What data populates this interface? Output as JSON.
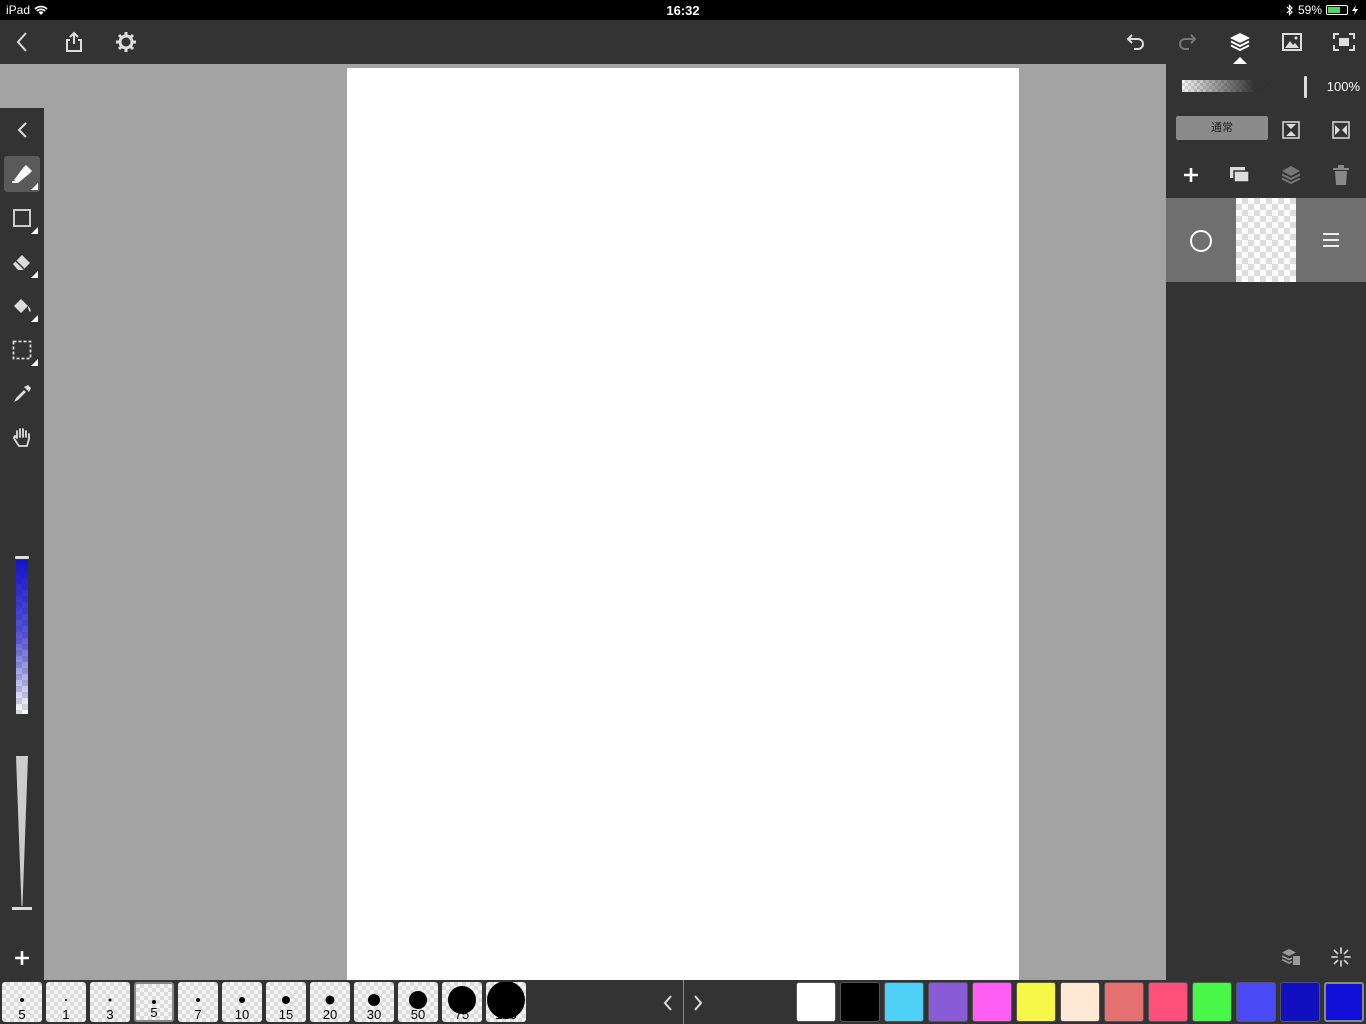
{
  "status_bar": {
    "device": "iPad",
    "time": "16:32",
    "battery": "59%"
  },
  "toolbar": {
    "left_icons": [
      "back-icon",
      "share-icon",
      "settings-icon"
    ],
    "right_icons": [
      "undo-icon",
      "redo-icon",
      "layers-icon",
      "image-icon",
      "fullscreen-icon"
    ]
  },
  "left_tools": [
    "collapse-icon",
    "pen-icon",
    "rectangle-icon",
    "eraser-icon",
    "fill-icon",
    "selection-icon",
    "eyedropper-icon",
    "hand-icon"
  ],
  "right_panel": {
    "opacity_label": "100%",
    "blend_mode": "通常",
    "layer_actions": [
      "add-layer-icon",
      "duplicate-layer-icon",
      "merge-layer-icon",
      "delete-layer-icon"
    ]
  },
  "brushes": [
    {
      "label": "5",
      "dot": 4
    },
    {
      "label": "1",
      "dot": 2
    },
    {
      "label": "3",
      "dot": 3
    },
    {
      "label": "5",
      "dot": 4
    },
    {
      "label": "7",
      "dot": 4
    },
    {
      "label": "10",
      "dot": 6
    },
    {
      "label": "15",
      "dot": 8
    },
    {
      "label": "20",
      "dot": 9
    },
    {
      "label": "30",
      "dot": 12
    },
    {
      "label": "50",
      "dot": 18
    },
    {
      "label": "75",
      "dot": 28
    },
    {
      "label": "100",
      "dot": 38
    }
  ],
  "palette": [
    "#ffffff",
    "#000000",
    "#4fd1f7",
    "#8a5bd6",
    "#ff5ef5",
    "#f7f748",
    "#ffe9d4",
    "#e57070",
    "#ff4f7b",
    "#48f748",
    "#4a4af7",
    "#1010c0",
    "#1010d8"
  ],
  "colors": {
    "selected": "#1010d8"
  }
}
